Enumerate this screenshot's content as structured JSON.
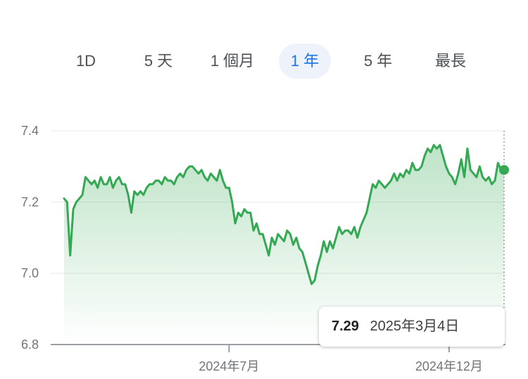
{
  "range_tabs": [
    {
      "label": "1D",
      "active": false
    },
    {
      "label": "5 天",
      "active": false
    },
    {
      "label": "1 個月",
      "active": false
    },
    {
      "label": "1 年",
      "active": true
    },
    {
      "label": "5 年",
      "active": false
    },
    {
      "label": "最長",
      "active": false
    }
  ],
  "tooltip": {
    "price": "7.29",
    "date": "2025年3月4日"
  },
  "colors": {
    "line": "#34a853",
    "active_tab": "#1a73e8",
    "active_tab_bg": "#eef3fb"
  },
  "chart_data": {
    "type": "area",
    "ylim": [
      6.8,
      7.4
    ],
    "y_ticks": [
      "7.4",
      "7.2",
      "7.0",
      "6.8"
    ],
    "y_tick_values": [
      7.4,
      7.2,
      7.0,
      6.8
    ],
    "x_ticks": [
      {
        "label": "2024年7月",
        "index": 54
      },
      {
        "label": "2024年12月",
        "index": 126
      }
    ],
    "grid": true,
    "series": [
      {
        "values": [
          7.21,
          7.2,
          7.05,
          7.18,
          7.2,
          7.21,
          7.22,
          7.27,
          7.26,
          7.25,
          7.26,
          7.24,
          7.27,
          7.25,
          7.25,
          7.27,
          7.24,
          7.26,
          7.27,
          7.25,
          7.25,
          7.22,
          7.17,
          7.23,
          7.22,
          7.23,
          7.22,
          7.24,
          7.25,
          7.25,
          7.26,
          7.26,
          7.25,
          7.27,
          7.26,
          7.26,
          7.25,
          7.27,
          7.28,
          7.27,
          7.29,
          7.3,
          7.3,
          7.29,
          7.28,
          7.29,
          7.27,
          7.26,
          7.28,
          7.27,
          7.26,
          7.29,
          7.26,
          7.24,
          7.24,
          7.2,
          7.14,
          7.17,
          7.16,
          7.18,
          7.17,
          7.17,
          7.12,
          7.14,
          7.11,
          7.11,
          7.08,
          7.05,
          7.1,
          7.08,
          7.11,
          7.1,
          7.09,
          7.12,
          7.11,
          7.08,
          7.1,
          7.07,
          7.06,
          7.03,
          7.0,
          6.97,
          6.98,
          7.02,
          7.05,
          7.09,
          7.06,
          7.09,
          7.07,
          7.1,
          7.13,
          7.11,
          7.12,
          7.12,
          7.11,
          7.13,
          7.1,
          7.13,
          7.15,
          7.17,
          7.21,
          7.25,
          7.24,
          7.26,
          7.25,
          7.24,
          7.25,
          7.26,
          7.28,
          7.26,
          7.28,
          7.27,
          7.29,
          7.28,
          7.31,
          7.29,
          7.29,
          7.3,
          7.33,
          7.35,
          7.34,
          7.36,
          7.35,
          7.36,
          7.33,
          7.3,
          7.28,
          7.27,
          7.25,
          7.28,
          7.32,
          7.27,
          7.35,
          7.29,
          7.28,
          7.27,
          7.3,
          7.27,
          7.26,
          7.27,
          7.25,
          7.26,
          7.31,
          7.29,
          7.29
        ]
      }
    ]
  }
}
